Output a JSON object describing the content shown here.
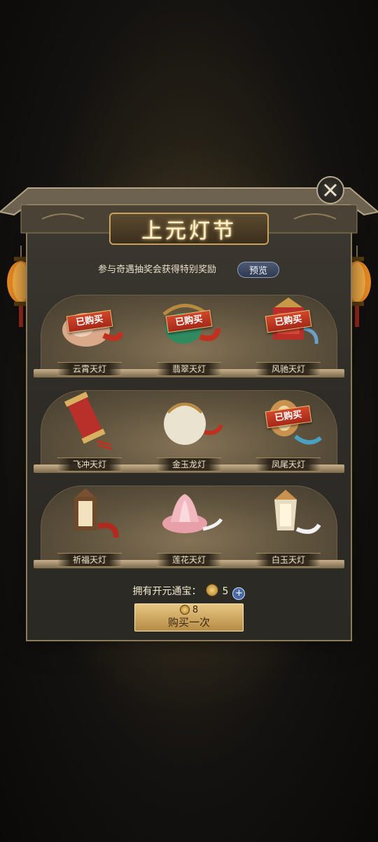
{
  "title": "上元灯节",
  "subtitle": "参与奇遇抽奖会获得特别奖励",
  "preview_label": "预览",
  "purchased_label": "已购买",
  "lanterns": [
    {
      "name": "云霄天灯",
      "purchased": true
    },
    {
      "name": "翡翠天灯",
      "purchased": true
    },
    {
      "name": "风驰天灯",
      "purchased": true
    },
    {
      "name": "飞冲天灯",
      "purchased": false
    },
    {
      "name": "金玉龙灯",
      "purchased": false
    },
    {
      "name": "凤尾天灯",
      "purchased": true
    },
    {
      "name": "祈福天灯",
      "purchased": false
    },
    {
      "name": "莲花天灯",
      "purchased": false
    },
    {
      "name": "白玉天灯",
      "purchased": false
    }
  ],
  "own_label": "拥有开元通宝：",
  "own_count": "5",
  "buy_cost": "8",
  "buy_label": "购买一次",
  "colors": {
    "accent_gold": "#c9a25a",
    "badge_red": "#c0392b"
  }
}
